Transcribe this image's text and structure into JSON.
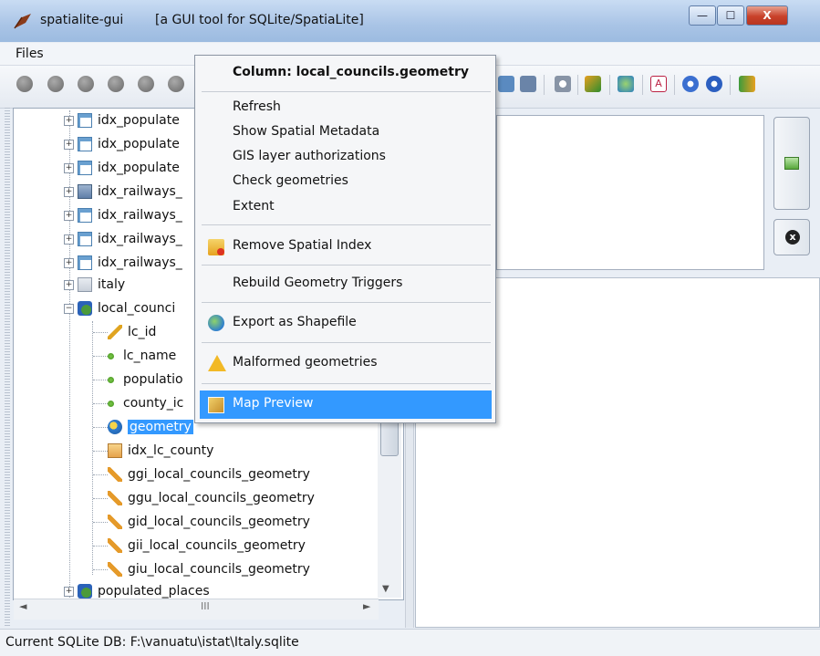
{
  "window": {
    "app_name": "spatialite-gui",
    "subtitle": "[a GUI tool for SQLite/SpatiaLite]",
    "minimize_glyph": "—",
    "maximize_glyph": "☐",
    "close_glyph": "X"
  },
  "menubar": {
    "files": "Files"
  },
  "tree": {
    "rows": [
      {
        "label": "idx_populate",
        "icon": "table-icon"
      },
      {
        "label": "idx_populate",
        "icon": "table-icon"
      },
      {
        "label": "idx_populate",
        "icon": "table-icon"
      },
      {
        "label": "idx_railways_",
        "icon": "railway-table-icon"
      },
      {
        "label": "idx_railways_",
        "icon": "table-icon"
      },
      {
        "label": "idx_railways_",
        "icon": "table-icon"
      },
      {
        "label": "idx_railways_",
        "icon": "table-icon"
      },
      {
        "label": "italy",
        "icon": "view-icon"
      },
      {
        "label": "local_counci",
        "icon": "gis-table-icon"
      },
      {
        "label": "lc_id",
        "icon": "key-icon"
      },
      {
        "label": "lc_name",
        "icon": "column-dot-icon"
      },
      {
        "label": "populatio",
        "icon": "column-dot-icon"
      },
      {
        "label": "county_ic",
        "icon": "column-dot-icon"
      },
      {
        "label": "geometry",
        "icon": "geometry-icon",
        "selected": true
      },
      {
        "label": "idx_lc_county",
        "icon": "index-icon"
      },
      {
        "label": "ggi_local_councils_geometry",
        "icon": "trigger-icon"
      },
      {
        "label": "ggu_local_councils_geometry",
        "icon": "trigger-icon"
      },
      {
        "label": "gid_local_councils_geometry",
        "icon": "trigger-icon"
      },
      {
        "label": "gii_local_councils_geometry",
        "icon": "trigger-icon"
      },
      {
        "label": "giu_local_councils_geometry",
        "icon": "trigger-icon"
      },
      {
        "label": "populated_places",
        "icon": "gis-table-icon"
      }
    ],
    "hscroll_left": "◄",
    "hscroll_right": "►",
    "hscroll_grip": "III",
    "vscroll_down": "▼",
    "expand_glyph": "+",
    "collapse_glyph": "−"
  },
  "context_menu": {
    "title": "Column: local_councils.geometry",
    "items": {
      "refresh": "Refresh",
      "show_metadata": "Show Spatial Metadata",
      "gis_auth": "GIS layer authorizations",
      "check_geom": "Check geometries",
      "extent": "Extent",
      "remove_index": "Remove Spatial Index",
      "rebuild_triggers": "Rebuild Geometry Triggers",
      "export_shapefile": "Export as Shapefile",
      "malformed": "Malformed geometries",
      "map_preview": "Map Preview"
    },
    "highlight_color": "#3399ff"
  },
  "sql_panel": {
    "clear_glyph": "x"
  },
  "status": {
    "text": "Current SQLite DB: F:\\vanuatu\\istat\\Italy.sqlite"
  }
}
